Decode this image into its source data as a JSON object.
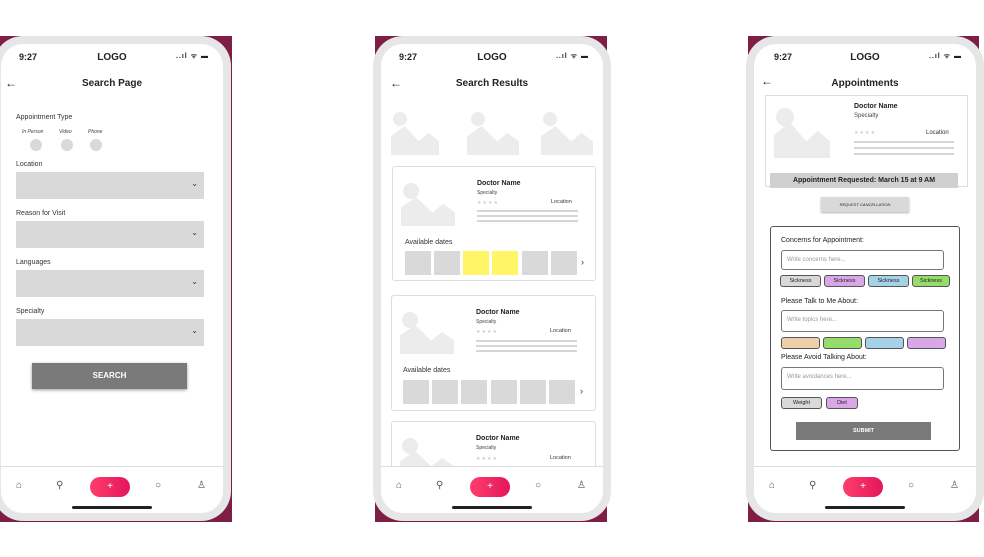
{
  "status_bar": {
    "time": "9:27",
    "logo": "LOGO",
    "signal": "..ıl ᯤ ▬"
  },
  "nav_icons": {
    "home": "⌂",
    "search": "⚲",
    "add": "+",
    "chat": "○",
    "profile": "♙"
  },
  "screen1": {
    "title": "Search Page",
    "appointment_type_label": "Appointment Type",
    "options": [
      "In Person",
      "Video",
      "Phone"
    ],
    "fields": [
      "Location",
      "Reason for Visit",
      "Languages",
      "Specialty"
    ],
    "search_label": "SEARCH"
  },
  "screen2": {
    "title": "Search Results",
    "cards": [
      {
        "name": "Doctor Name",
        "specialty": "Specialty",
        "stars": "★★★★",
        "location": "Location",
        "available_label": "Available dates"
      },
      {
        "name": "Doctor Name",
        "specialty": "Specialty",
        "stars": "★★★★",
        "location": "Location",
        "available_label": "Available dates"
      },
      {
        "name": "Doctor Name",
        "specialty": "Specialty",
        "stars": "★★★★",
        "location": "Location"
      }
    ]
  },
  "screen3": {
    "title": "Appointments",
    "doctor": {
      "name": "Doctor Name",
      "specialty": "Specialty",
      "stars": "★★★★",
      "location": "Location"
    },
    "banner": "Appointment Requested: March 15 at 9 AM",
    "cancel_label": "REQUEST CANCELLATION",
    "concerns_label": "Concerns for Appointment:",
    "concerns_placeholder": "Write concerns here...",
    "concern_chips": [
      "Sickness",
      "Sickness",
      "Sickness",
      "Sickness"
    ],
    "talk_label": "Please Talk to Me About:",
    "talk_placeholder": "Write topics here...",
    "avoid_label": "Please Avoid Talking About:",
    "avoid_placeholder": "Write avoidances here...",
    "avoid_chips": [
      "Weight",
      "Diet"
    ],
    "submit_label": "SUBMIT"
  },
  "colors": {
    "backdrop": "#7e1e45",
    "fab": "#e3165b",
    "selected_date": "#fff566",
    "chip_gray": "#d9d9d9",
    "chip_purple": "#d9a6e8",
    "chip_blue": "#a6d2e8",
    "chip_green": "#95dc6a",
    "chip_tan": "#eed0a8"
  }
}
